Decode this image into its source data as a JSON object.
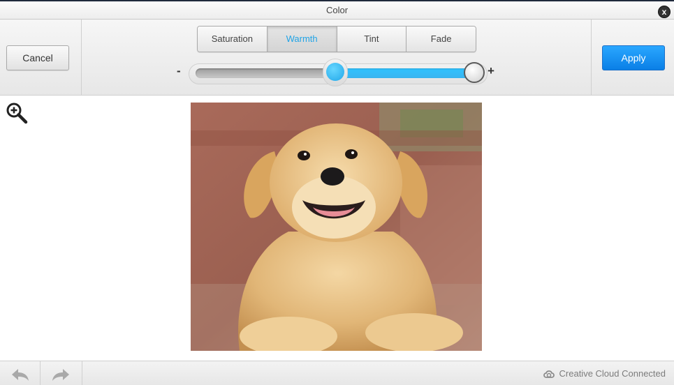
{
  "window": {
    "title": "Color"
  },
  "toolbar": {
    "cancel_label": "Cancel",
    "apply_label": "Apply",
    "tabs": [
      {
        "label": "Saturation",
        "active": false
      },
      {
        "label": "Warmth",
        "active": true
      },
      {
        "label": "Tint",
        "active": false
      },
      {
        "label": "Fade",
        "active": false
      }
    ],
    "slider": {
      "minus_label": "-",
      "plus_label": "+",
      "value_fraction": 1.0
    }
  },
  "footer": {
    "status_label": "Creative Cloud Connected"
  },
  "icons": {
    "close": "close-icon",
    "zoom": "zoom-in-icon",
    "undo": "undo-icon",
    "redo": "redo-icon",
    "cloud": "creative-cloud-icon"
  },
  "colors": {
    "accent": "#21a4e6",
    "apply_button": "#0a7fe6",
    "slider_fill": "#30c3ff"
  }
}
